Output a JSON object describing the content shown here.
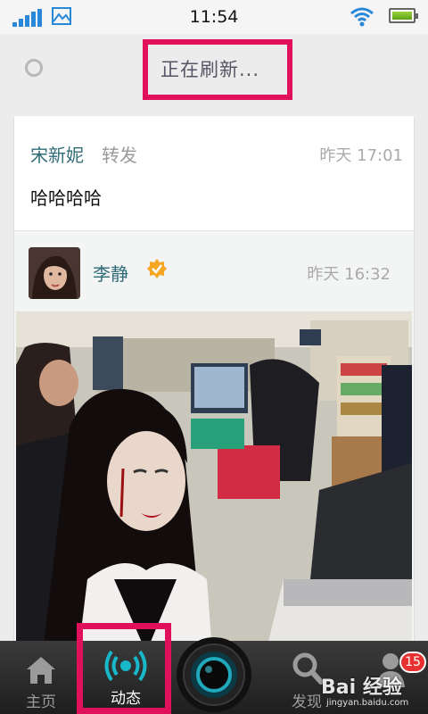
{
  "status_bar": {
    "time": "11:54"
  },
  "refresh": {
    "label": "正在刷新..."
  },
  "post": {
    "author": "宋新妮",
    "action": "转发",
    "time": "昨天 17:01",
    "text": "哈哈哈哈",
    "original": {
      "author": "李静",
      "time": "昨天 16:32",
      "verified": true
    }
  },
  "tabbar": {
    "home_label": "主页",
    "activity_label": "动态",
    "discover_label": "发现",
    "notification_count": "15"
  },
  "watermark": {
    "text": "Bai 经验",
    "sub": "jingyan.baidu.com"
  },
  "colors": {
    "highlight": "#e0105a",
    "accent": "#2f6c78",
    "active_tab": "#18b7c9"
  }
}
